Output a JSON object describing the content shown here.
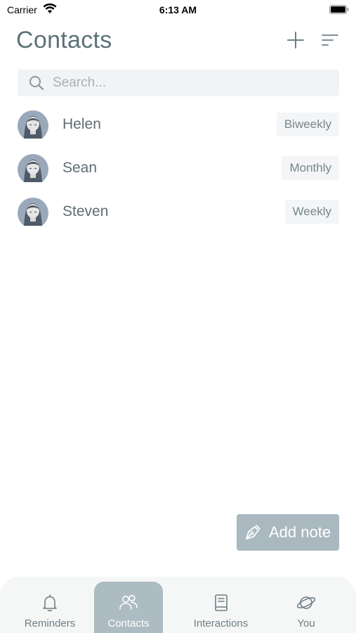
{
  "status_bar": {
    "carrier": "Carrier",
    "time": "6:13 AM"
  },
  "header": {
    "title": "Contacts",
    "add_icon": "plus-icon",
    "sort_icon": "sort-lines-icon"
  },
  "search": {
    "placeholder": "Search...",
    "value": ""
  },
  "contacts": [
    {
      "name": "Helen",
      "frequency": "Biweekly"
    },
    {
      "name": "Sean",
      "frequency": "Monthly"
    },
    {
      "name": "Steven",
      "frequency": "Weekly"
    }
  ],
  "add_note": {
    "label": "Add note",
    "icon": "pen-nib-icon"
  },
  "tabs": [
    {
      "label": "Reminders",
      "icon": "bell-icon",
      "active": false
    },
    {
      "label": "Contacts",
      "icon": "people-icon",
      "active": true
    },
    {
      "label": "Interactions",
      "icon": "book-icon",
      "active": false
    },
    {
      "label": "You",
      "icon": "planet-icon",
      "active": false
    }
  ],
  "colors": {
    "accent": "#aab9bf",
    "title": "#5c7278",
    "badge_bg": "#f3f5f6",
    "tab_bar_bg": "#f5f6f6",
    "avatar": "#9aa9b9"
  }
}
